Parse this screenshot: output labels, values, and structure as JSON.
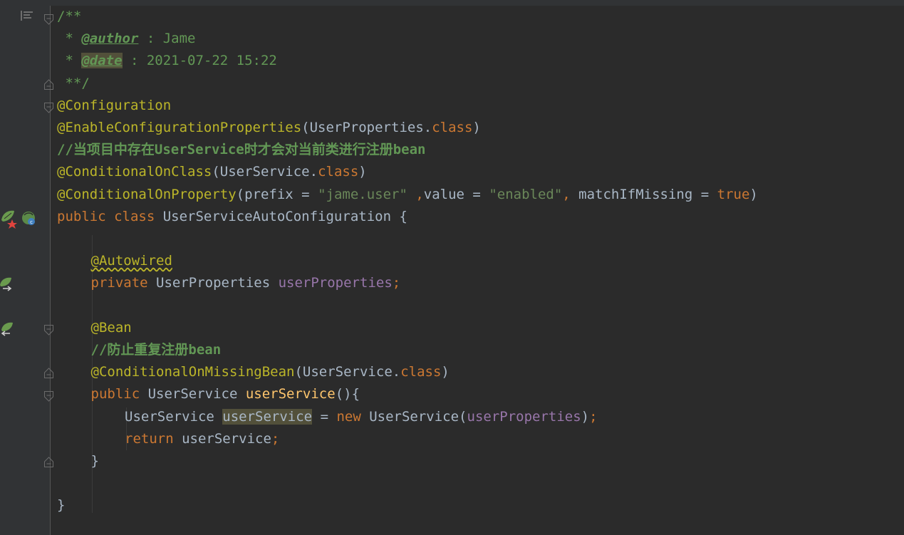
{
  "editor": {
    "language": "java",
    "colors": {
      "background": "#2b2b2b",
      "gutter": "#313335",
      "comment": "#629755",
      "annotation": "#bbb529",
      "keyword": "#cc7832",
      "string": "#6a8759",
      "field": "#9876aa",
      "method": "#ffc66d",
      "plain": "#a9b7c6"
    },
    "gutter_icons": [
      "structure-icon",
      "spring-bean-icon",
      "autowired-navigate-icon",
      "bean-navigate-icon"
    ],
    "lines": [
      {
        "indent": 0,
        "tokens": [
          {
            "c": "cmt",
            "t": "/**"
          }
        ]
      },
      {
        "indent": 0,
        "tokens": [
          {
            "c": "cmt",
            "t": " * "
          },
          {
            "c": "dtag",
            "t": "@author"
          },
          {
            "c": "cmt",
            "t": " : Jame"
          }
        ]
      },
      {
        "indent": 0,
        "tokens": [
          {
            "c": "cmt",
            "t": " * "
          },
          {
            "c": "dtag dtag-hl",
            "t": "@date"
          },
          {
            "c": "cmt",
            "t": " : 2021-07-22 15:22"
          }
        ]
      },
      {
        "indent": 0,
        "tokens": [
          {
            "c": "cmt",
            "t": " **/"
          }
        ]
      },
      {
        "indent": 0,
        "tokens": [
          {
            "c": "ann",
            "t": "@Configuration"
          }
        ]
      },
      {
        "indent": 0,
        "tokens": [
          {
            "c": "ann",
            "t": "@EnableConfigurationProperties"
          },
          {
            "c": "pln",
            "t": "(UserProperties."
          },
          {
            "c": "kw",
            "t": "class"
          },
          {
            "c": "pln",
            "t": ")"
          }
        ]
      },
      {
        "indent": 0,
        "tokens": [
          {
            "c": "lc",
            "t": "//当项目中存在UserService时才会对当前类进行注册bean"
          }
        ]
      },
      {
        "indent": 0,
        "tokens": [
          {
            "c": "ann",
            "t": "@ConditionalOnClass"
          },
          {
            "c": "pln",
            "t": "(UserService."
          },
          {
            "c": "kw",
            "t": "class"
          },
          {
            "c": "pln",
            "t": ")"
          }
        ]
      },
      {
        "indent": 0,
        "tokens": [
          {
            "c": "ann",
            "t": "@ConditionalOnProperty"
          },
          {
            "c": "pln",
            "t": "(prefix = "
          },
          {
            "c": "str",
            "t": "\"jame.user\""
          },
          {
            "c": "kw",
            "t": " ,"
          },
          {
            "c": "pln",
            "t": "value = "
          },
          {
            "c": "str",
            "t": "\"enabled\""
          },
          {
            "c": "kw",
            "t": ", "
          },
          {
            "c": "pln",
            "t": "matchIfMissing = "
          },
          {
            "c": "kw",
            "t": "true"
          },
          {
            "c": "pln",
            "t": ")"
          }
        ]
      },
      {
        "indent": 0,
        "tokens": [
          {
            "c": "kw",
            "t": "public class "
          },
          {
            "c": "pln",
            "t": "UserServiceAutoConfiguration {"
          }
        ]
      },
      {
        "indent": 0,
        "tokens": []
      },
      {
        "indent": 1,
        "tokens": [
          {
            "c": "ann squiggle",
            "t": "@Autowired"
          }
        ]
      },
      {
        "indent": 1,
        "tokens": [
          {
            "c": "kw",
            "t": "private "
          },
          {
            "c": "pln",
            "t": "UserProperties "
          },
          {
            "c": "fld",
            "t": "userProperties"
          },
          {
            "c": "kw",
            "t": ";"
          }
        ]
      },
      {
        "indent": 0,
        "tokens": []
      },
      {
        "indent": 1,
        "tokens": [
          {
            "c": "ann",
            "t": "@Bean"
          }
        ]
      },
      {
        "indent": 1,
        "tokens": [
          {
            "c": "lc",
            "t": "//防止重复注册bean"
          }
        ]
      },
      {
        "indent": 1,
        "tokens": [
          {
            "c": "ann",
            "t": "@ConditionalOnMissingBean"
          },
          {
            "c": "pln",
            "t": "(UserService."
          },
          {
            "c": "kw",
            "t": "class"
          },
          {
            "c": "pln",
            "t": ")"
          }
        ]
      },
      {
        "indent": 1,
        "tokens": [
          {
            "c": "kw",
            "t": "public "
          },
          {
            "c": "pln",
            "t": "UserService "
          },
          {
            "c": "meth",
            "t": "userService"
          },
          {
            "c": "pln",
            "t": "(){"
          }
        ]
      },
      {
        "indent": 2,
        "tokens": [
          {
            "c": "pln",
            "t": "UserService "
          },
          {
            "c": "pln hl-var",
            "t": "userService"
          },
          {
            "c": "pln",
            "t": " = "
          },
          {
            "c": "kw",
            "t": "new "
          },
          {
            "c": "pln",
            "t": "UserService("
          },
          {
            "c": "fld",
            "t": "userProperties"
          },
          {
            "c": "pln",
            "t": ")"
          },
          {
            "c": "kw",
            "t": ";"
          }
        ]
      },
      {
        "indent": 2,
        "tokens": [
          {
            "c": "kw",
            "t": "return "
          },
          {
            "c": "pln",
            "t": "userService"
          },
          {
            "c": "kw",
            "t": ";"
          }
        ]
      },
      {
        "indent": 1,
        "tokens": [
          {
            "c": "pln",
            "t": "}"
          }
        ]
      },
      {
        "indent": 0,
        "tokens": []
      },
      {
        "indent": 0,
        "tokens": [
          {
            "c": "pln",
            "t": "}"
          }
        ]
      }
    ]
  }
}
